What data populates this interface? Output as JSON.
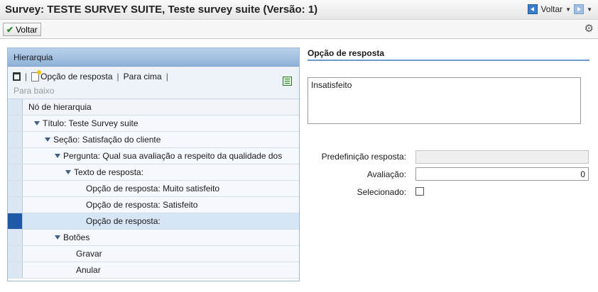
{
  "window": {
    "title": "Survey: TESTE SURVEY SUITE, Teste survey suite (Versão: 1)",
    "back_label": "Voltar"
  },
  "toolbar": {
    "voltar_button": "Voltar"
  },
  "hierarchy": {
    "header": "Hierarquia",
    "actions": {
      "new_option": "Opção de resposta",
      "move_up": "Para cima",
      "move_down": "Para baixo"
    },
    "column_header": "Nó de hierarquia",
    "rows": [
      {
        "label": "Título: Teste Survey suite",
        "expanded": true
      },
      {
        "label": "Seção: Satisfação do cliente",
        "expanded": true
      },
      {
        "label": "Pergunta: Qual sua avaliação a respeito da qualidade dos",
        "expanded": true
      },
      {
        "label": "Texto de resposta:",
        "expanded": true
      },
      {
        "label": "Opção de resposta: Muito satisfeito"
      },
      {
        "label": "Opção de resposta: Satisfeito"
      },
      {
        "label": "Opção de resposta:",
        "selected": true
      },
      {
        "label": "Botões",
        "expanded": true
      },
      {
        "label": "Gravar"
      },
      {
        "label": "Anular"
      }
    ]
  },
  "detail": {
    "section_title": "Opção de resposta",
    "text_value": "Insatisfeito",
    "fields": {
      "predef_label": "Predefinição resposta:",
      "predef_value": "",
      "rating_label": "Avaliação:",
      "rating_value": "0",
      "selected_label": "Selecionado:",
      "selected_checked": false
    }
  },
  "colors": {
    "accent": "#1f5aa6",
    "header_blue": "#8fb2d9",
    "selected_row": "#d7e6f6"
  }
}
